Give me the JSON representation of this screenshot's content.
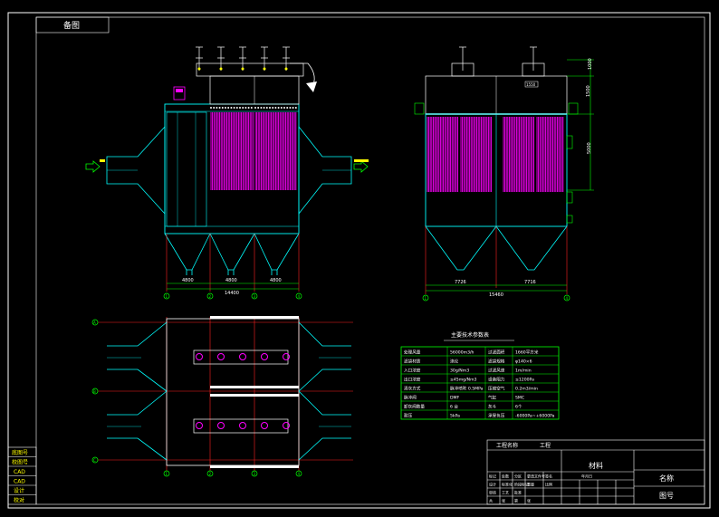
{
  "top_label": "备图",
  "left_stamps": [
    "底图号",
    "校图号",
    "CAD",
    "CAD",
    "设计",
    "校对"
  ],
  "front_view": {
    "dim_segments": [
      "4800",
      "4800",
      "4800"
    ],
    "dim_total": "14400",
    "axis_marks": [
      "1",
      "2",
      "3",
      "4"
    ]
  },
  "side_view": {
    "dim_segments": [
      "7726",
      "7716"
    ],
    "dim_total": "15460",
    "axis_marks": [
      "1",
      "4"
    ],
    "top_dim": "1550",
    "right_dims": [
      "1000",
      "1500",
      "5000"
    ]
  },
  "plan_view": {
    "axis_marks": [
      "1",
      "2",
      "3",
      "4"
    ],
    "row_marks": [
      "A",
      "B",
      "C"
    ]
  },
  "params": {
    "title": "主要技术参数表",
    "rows": [
      [
        "处理风量",
        "56000m3/h",
        "过滤面积",
        "1660平方米"
      ],
      [
        "滤袋材质",
        "涤纶",
        "滤袋规格",
        "φ140×6"
      ],
      [
        "入口浓度",
        "30g/Nm3",
        "过滤风速",
        "1m/min"
      ],
      [
        "出口浓度",
        "≤45mg/Nm3",
        "设备阻力",
        "≤1200Pa"
      ],
      [
        "清灰方式",
        "脉冲喷吹 0.5MPa",
        "压缩空气",
        "0.2m3/min"
      ],
      [
        "脉冲阀",
        "DMF",
        "气缸",
        "SMC"
      ],
      [
        "卸灰阀数量",
        "6 台",
        "灰斗",
        "6个"
      ],
      [
        "耐压",
        "5kPa",
        "承受负压",
        "-6000Pa~+6000Pa"
      ]
    ]
  },
  "title_block": {
    "work_label": "工程名称",
    "work_value": "工程",
    "material": "材料",
    "name_label": "名称",
    "drawing_no": "图号",
    "sub_row1": [
      "标记",
      "处数",
      "分区",
      "更改文件号",
      "签名",
      "年月日"
    ],
    "sub_row2": [
      "设计",
      "标准化",
      "阶段标记",
      "重量",
      "比例"
    ],
    "sub_row3": [
      "审核",
      "工艺",
      "批准"
    ],
    "sheet_row": [
      "共",
      "张",
      "第",
      "张"
    ]
  }
}
